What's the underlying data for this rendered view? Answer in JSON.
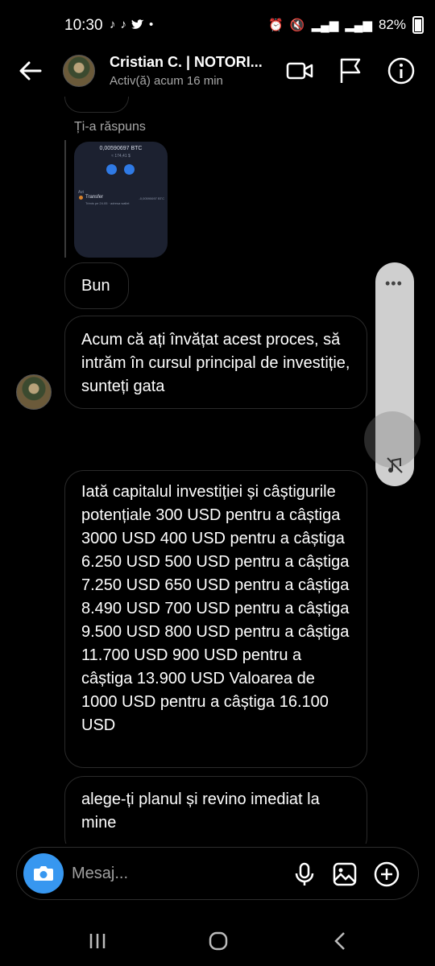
{
  "status_bar": {
    "time": "10:30",
    "battery": "82%"
  },
  "header": {
    "name": "Cristian C. | NOTORI...",
    "status": "Activ(ă) acum 16 min"
  },
  "reply": {
    "label": "Ți-a răspuns",
    "thumbnail": {
      "amount": "0,00590697 BTC",
      "sub": "≈ 174,41 $",
      "section": "Azi",
      "tx_title": "Transfer",
      "tx_sub": "Trimis pe 24.05 · adresa wallet",
      "tx_amount": "-0,00590697 BTC"
    }
  },
  "messages": [
    {
      "text": "Bun"
    },
    {
      "text": "Acum că ați învățat acest proces, să intrăm în cursul principal de investiție, sunteți gata"
    },
    {
      "text": "Iată capitalul investiției și câștigurile potențiale 300 USD pentru a câștiga 3000 USD 400 USD pentru a câștiga 6.250 USD 500 USD pentru a câștiga 7.250 USD 650 USD pentru a câștiga 8.490 USD 700 USD pentru a câștiga 9.500 USD 800 USD pentru a câștiga 11.700 USD 900 USD pentru a câștiga 13.900 USD Valoarea de 1000 USD pentru a câștiga 16.100 USD"
    },
    {
      "text": "alege-ți planul și revino imediat la mine"
    }
  ],
  "composer": {
    "placeholder": "Mesaj..."
  },
  "colors": {
    "background": "#000000",
    "accent": "#3797f0",
    "secondary_text": "#a8a8a8"
  }
}
